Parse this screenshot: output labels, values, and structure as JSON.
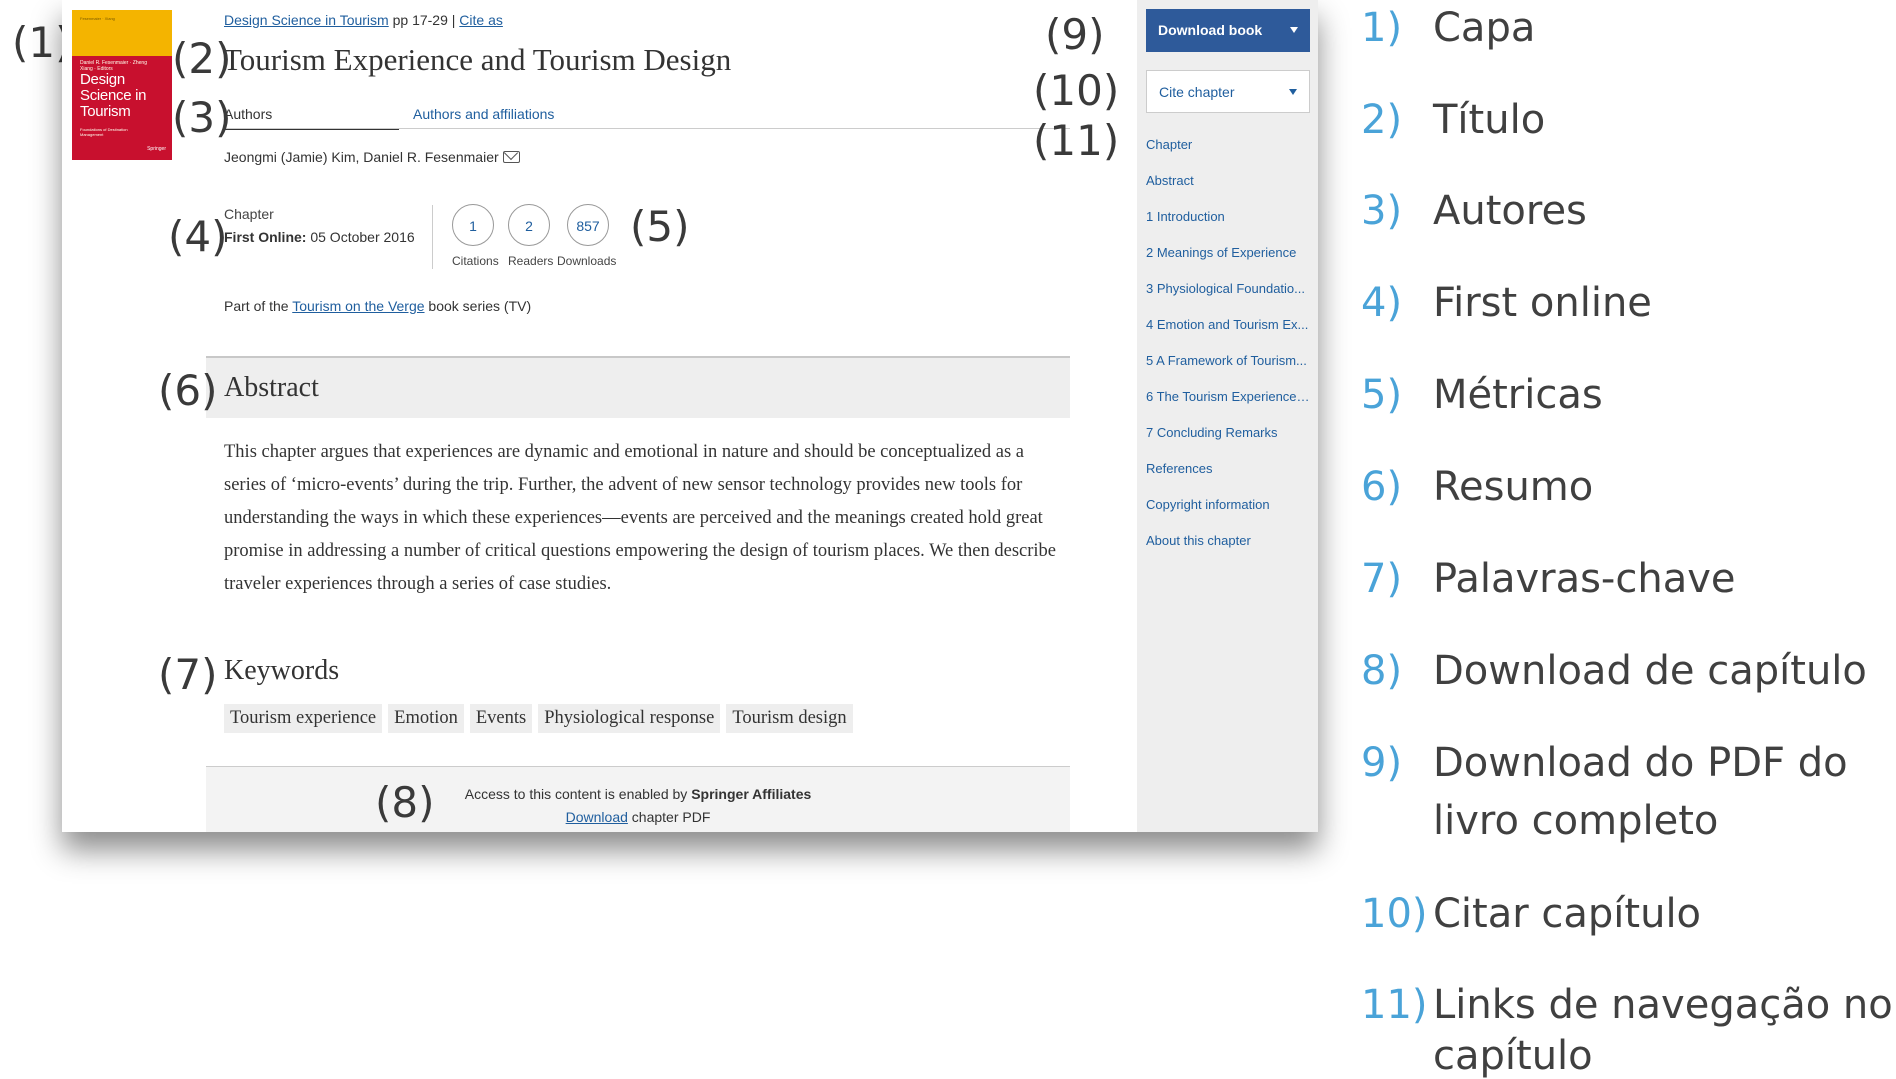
{
  "callouts": {
    "c1": "(1)",
    "c2": "(2)",
    "c3": "(3)",
    "c4": "(4)",
    "c5": "(5)",
    "c6": "(6)",
    "c7": "(7)",
    "c8": "(8)",
    "c9": "(9)",
    "c10": "(10)",
    "c11": "(11)"
  },
  "cover": {
    "top_text": "Fesenmaier · Xiang",
    "editors": "Daniel R. Fesenmaier · Zheng Xiang · Editors",
    "title_line1": "Design",
    "title_line2": "Science in",
    "title_line3": "Tourism",
    "subtitle": "Foundations of Destination Management",
    "publisher": "Springer"
  },
  "breadcrumb": {
    "book": "Design Science in Tourism",
    "pages": " pp 17-29 | ",
    "cite_as": "Cite as"
  },
  "title": "Tourism Experience and Tourism Design",
  "tabs": {
    "authors": "Authors",
    "affiliations": "Authors and affiliations"
  },
  "authors": "Jeongmi (Jamie) Kim, Daniel R. Fesenmaier",
  "meta": {
    "type": "Chapter",
    "first_online_label": "First Online:",
    "first_online_value": " 05 October 2016"
  },
  "metrics": [
    {
      "value": "1",
      "label": "Citations"
    },
    {
      "value": "2",
      "label": "Readers"
    },
    {
      "value": "857",
      "label": "Downloads"
    }
  ],
  "series": {
    "prefix": "Part of the ",
    "link": "Tourism on the Verge",
    "suffix": " book series (TV)"
  },
  "abstract": {
    "heading": "Abstract",
    "text": "This chapter argues that experiences are dynamic and emotional in nature and should be conceptualized as a series of ‘micro-events’ during the trip. Further, the advent of new sensor technology provides new tools for understanding the ways in which these experiences—events are perceived and the meanings created hold great promise in addressing a number of critical questions empowering the design of tourism places. We then describe traveler experiences through a series of case studies."
  },
  "keywords": {
    "heading": "Keywords",
    "items": [
      "Tourism experience",
      "Emotion",
      "Events",
      "Physiological response",
      "Tourism design"
    ]
  },
  "access": {
    "text": "Access to this content is enabled by ",
    "org": "Springer Affiliates",
    "download_link": "Download",
    "download_suffix": " chapter PDF"
  },
  "sidebar": {
    "download_book": "Download book",
    "cite_chapter": "Cite chapter",
    "toc": [
      "Chapter",
      "Abstract",
      "1 Introduction",
      "2 Meanings of Experience",
      "3 Physiological Foundatio...",
      "4 Emotion and Tourism Ex...",
      "5 A Framework of Tourism...",
      "6 The Tourism Experience ...",
      "7 Concluding Remarks",
      "References",
      "Copyright information",
      "About this chapter"
    ]
  },
  "legend": [
    {
      "num": "1)",
      "text": "Capa"
    },
    {
      "num": "2)",
      "text": "Título"
    },
    {
      "num": "3)",
      "text": "Autores"
    },
    {
      "num": "4)",
      "text": "First online"
    },
    {
      "num": "5)",
      "text": "Métricas"
    },
    {
      "num": "6)",
      "text": "Resumo"
    },
    {
      "num": "7)",
      "text": "Palavras-chave"
    },
    {
      "num": "8)",
      "text": "Download de capítulo"
    },
    {
      "num": "9)",
      "text": "Download  do PDF do",
      "text2": "livro completo"
    },
    {
      "num": "10)",
      "text": "Citar capítulo"
    },
    {
      "num": "11)",
      "text": " Links de navegação no",
      "text2": "capítulo"
    }
  ]
}
